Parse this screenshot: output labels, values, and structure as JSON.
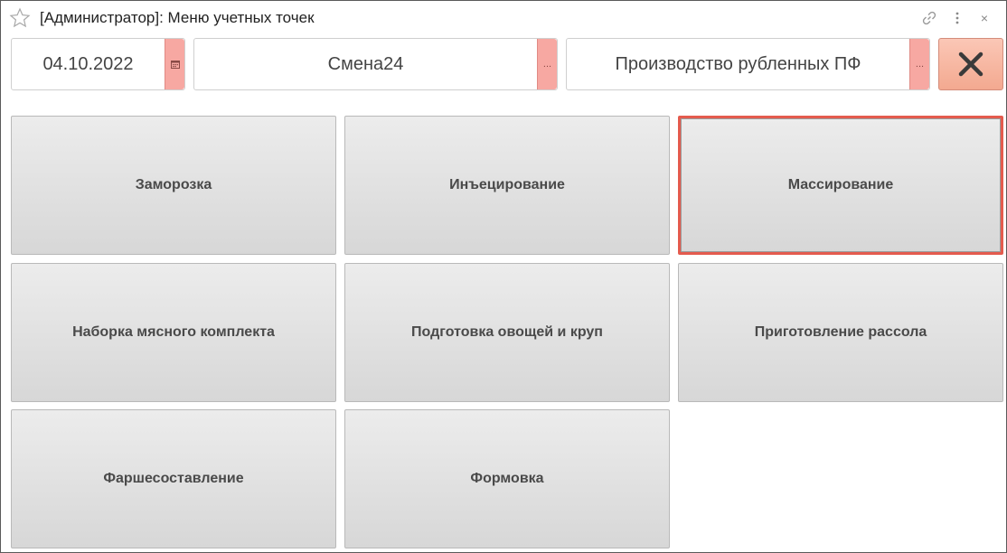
{
  "window": {
    "title": "[Администратор]: Меню учетных точек",
    "icons": {
      "favorite": "star-icon",
      "link": "link-icon",
      "more": "more-vertical-icon",
      "close": "close-icon"
    },
    "close_glyph": "×"
  },
  "header": {
    "date": {
      "value": "04.10.2022",
      "button_icon": "calendar-icon"
    },
    "shift": {
      "value": "Смена24",
      "button_label": "..."
    },
    "production": {
      "value": "Производство рубленных ПФ",
      "button_label": "..."
    },
    "exit_button_icon": "close-x-icon"
  },
  "tiles": [
    {
      "label": "Заморозка",
      "selected": false
    },
    {
      "label": "Инъецирование",
      "selected": false
    },
    {
      "label": "Массирование",
      "selected": true
    },
    {
      "label": "Наборка мясного комплекта",
      "selected": false
    },
    {
      "label": "Подготовка овощей и круп",
      "selected": false
    },
    {
      "label": "Приготовление рассола",
      "selected": false
    },
    {
      "label": "Фаршесоставление",
      "selected": false
    },
    {
      "label": "Формовка",
      "selected": false
    }
  ],
  "colors": {
    "selection_border": "#e45b4e",
    "field_button": "#f7a8a2",
    "exit_button": "#f3a990"
  }
}
